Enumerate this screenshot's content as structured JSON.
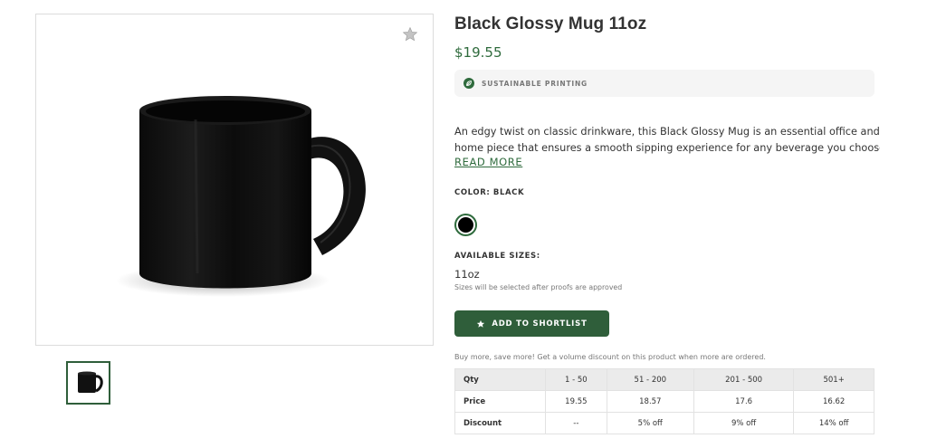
{
  "product": {
    "title": "Black Glossy Mug 11oz",
    "price": "$19.55",
    "badge": "SUSTAINABLE PRINTING",
    "description_line1": "An edgy twist on classic drinkware, this Black Glossy Mug is an essential office and",
    "description_line2": "home piece that ensures a smooth sipping experience for any beverage you choose....",
    "read_more": "READ MORE",
    "color_label": "COLOR: BLACK",
    "color_swatch": "#000000",
    "sizes_label": "AVAILABLE SIZES:",
    "size_value": "11oz",
    "size_note": "Sizes will be selected after proofs are approved",
    "add_button": "ADD TO SHORTLIST",
    "volume_note": "Buy more, save more! Get a volume discount on this product when more are ordered."
  },
  "volume_table": {
    "header": [
      "Qty",
      "1 - 50",
      "51 - 200",
      "201 - 500",
      "501+"
    ],
    "price_row": [
      "Price",
      "19.55",
      "18.57",
      "17.6",
      "16.62"
    ],
    "discount_row": [
      "Discount",
      "--",
      "5% off",
      "9% off",
      "14% off"
    ]
  },
  "colors": {
    "accent": "#2f5e3a",
    "price": "#2f6b3d"
  },
  "icons": {
    "favorite": "star-icon",
    "badge": "leaf-icon",
    "button": "star-icon"
  }
}
